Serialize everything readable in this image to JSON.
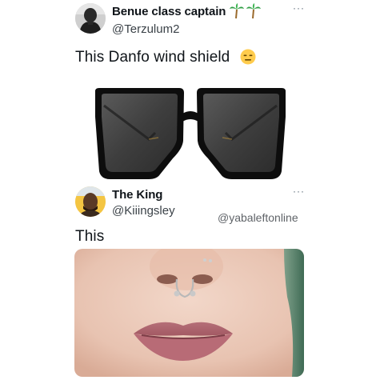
{
  "tweet1": {
    "author_name": "Benue class captain",
    "name_emoji": "palm-tree-icons",
    "handle": "@Terzulum2",
    "more": "···",
    "text": "This Danfo wind shield",
    "text_emoji": "expressionless-face-icon",
    "image": "oversized-square-black-sunglasses"
  },
  "tweet2": {
    "author_name": "The King",
    "handle": "@Kiiingsley",
    "more": "···",
    "text": "This",
    "image": "septum-piercing-close-up"
  },
  "watermark": "@yabaleftonline",
  "colors": {
    "text": "#0f1419",
    "secondary": "#536471",
    "palm_green": "#2f9e44",
    "palm_trunk": "#9a6a2c",
    "emoji_yellow": "#ffcc4d"
  }
}
